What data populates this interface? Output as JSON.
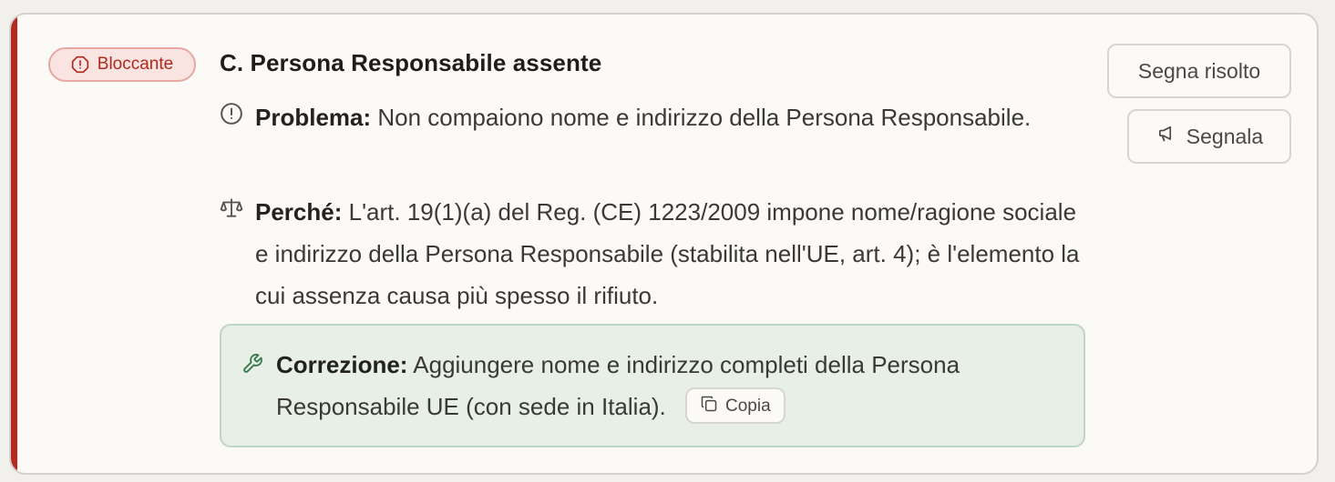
{
  "issue": {
    "severity": {
      "label": "Bloccante",
      "icon": "alert-octagon-icon",
      "color": "#b42a20"
    },
    "title": "C. Persona Responsabile assente",
    "problem": {
      "label": "Problema:",
      "text": "Non compaiono nome e indirizzo della Persona Responsabile.",
      "icon": "alert-circle-icon"
    },
    "why": {
      "label": "Perché:",
      "text": "L'art. 19(1)(a) del Reg. (CE) 1223/2009 impone nome/ragione sociale e indirizzo della Persona Responsabile (stabilita nell'UE, art. 4); è l'elemento la cui assenza causa più spesso il rifiuto.",
      "icon": "scale-icon"
    },
    "fix": {
      "label": "Correzione:",
      "text": "Aggiungere nome e indirizzo completi della Persona Responsabile UE (con sede in Italia).",
      "icon": "wrench-icon",
      "copy_label": "Copia",
      "copy_icon": "copy-icon",
      "accent": "#3a7a4c"
    }
  },
  "actions": {
    "resolve_label": "Segna risolto",
    "report_label": "Segnala",
    "report_icon": "megaphone-icon"
  }
}
